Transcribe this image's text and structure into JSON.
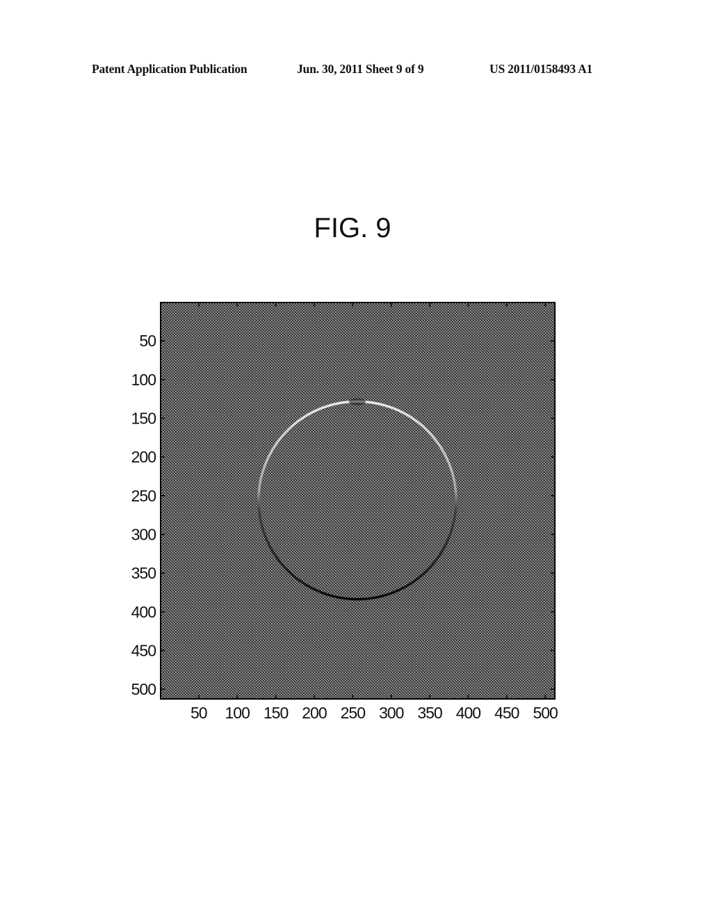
{
  "header": {
    "left": "Patent Application Publication",
    "middle": "Jun. 30, 2011  Sheet 9 of 9",
    "right": "US 2011/0158493 A1"
  },
  "figure": {
    "title": "FIG. 9"
  },
  "chart_data": {
    "type": "heatmap",
    "title": "FIG. 9",
    "description": "Grayscale image (approx. 512x512) of a uniform mid-gray textured background with a circular ring edge; upper arc bright, lower arc dark",
    "xlabel": "",
    "ylabel": "",
    "xlim": [
      0.5,
      512.5
    ],
    "ylim": [
      512.5,
      0.5
    ],
    "x_ticks": [
      50,
      100,
      150,
      200,
      250,
      300,
      350,
      400,
      450,
      500
    ],
    "y_ticks": [
      50,
      100,
      150,
      200,
      250,
      300,
      350,
      400,
      450,
      500
    ],
    "x_tick_labels": [
      "50",
      "100",
      "150",
      "200",
      "250",
      "300",
      "350",
      "400",
      "450",
      "500"
    ],
    "y_tick_labels": [
      "50",
      "100",
      "150",
      "200",
      "250",
      "300",
      "350",
      "400",
      "450",
      "500"
    ],
    "grid": false,
    "colormap": "gray",
    "background_level": "mid-gray",
    "features": [
      {
        "name": "ring",
        "shape": "circle",
        "center": [
          256,
          256
        ],
        "radius": 128,
        "upper_arc": "bright",
        "lower_arc": "dark"
      },
      {
        "name": "top-dark-spot",
        "center": [
          256,
          126
        ]
      }
    ]
  }
}
